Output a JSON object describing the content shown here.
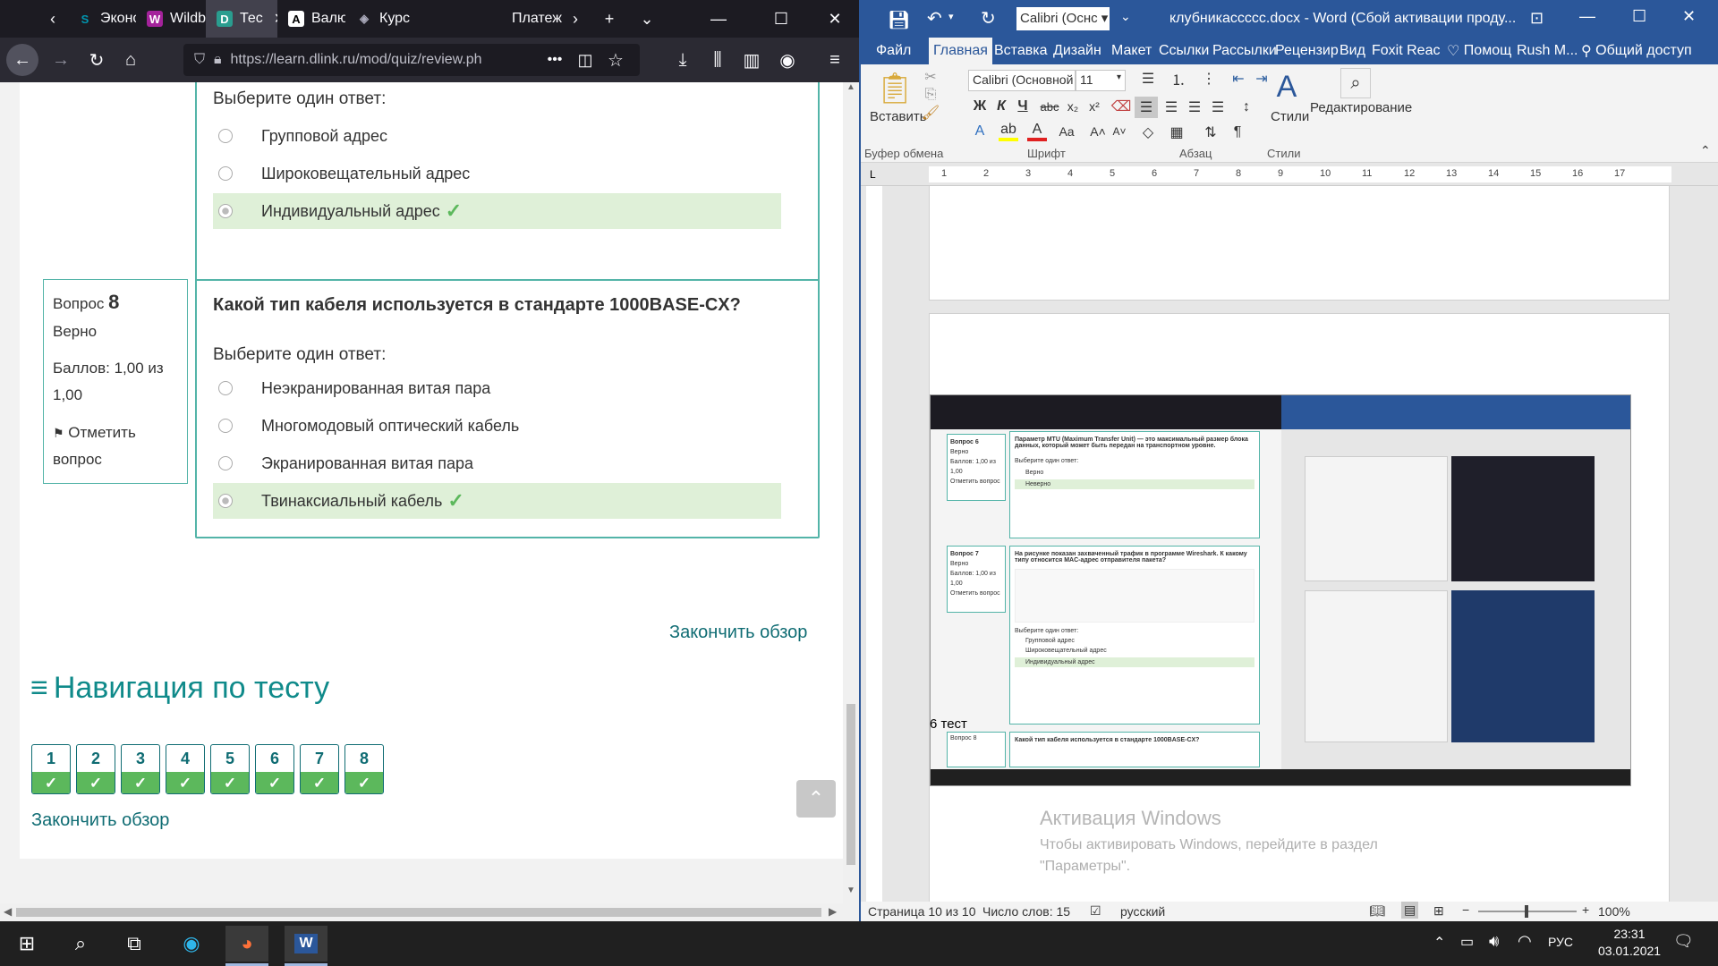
{
  "browser": {
    "tabs": [
      {
        "label": "Эконо",
        "fav": "S",
        "fav_color": "#0096b0"
      },
      {
        "label": "Wildb",
        "fav": "W",
        "fav_color": "#a4229b"
      },
      {
        "label": "Тес",
        "fav": "D",
        "fav_color": "#2a9d8f"
      },
      {
        "label": "Валют",
        "fav": "A",
        "fav_color": "#ffffff"
      },
      {
        "label": "Курс",
        "fav": "◈",
        "fav_color": "#7a8a9a"
      },
      {
        "label": "Платеж",
        "fav": "",
        "fav_color": "#1c1b22"
      }
    ],
    "url": "https://learn.dlink.ru/mod/quiz/review.ph"
  },
  "quiz": {
    "prev_question": {
      "prompt": "Выберите один ответ:",
      "options": [
        {
          "label": "Групповой адрес",
          "correct": false
        },
        {
          "label": "Широковещательный адрес",
          "correct": false
        },
        {
          "label": "Индивидуальный адрес",
          "correct": true
        }
      ]
    },
    "question8": {
      "info_label": "Вопрос",
      "info_number": "8",
      "status": "Верно",
      "score_line1": "Баллов: 1,00 из",
      "score_line2": "1,00",
      "flag_line1": "Отметить",
      "flag_line2": "вопрос",
      "text": "Какой тип кабеля используется в стандарте 1000BASE-CX?",
      "prompt": "Выберите один ответ:",
      "options": [
        {
          "label": "Неэкранированная витая пара",
          "correct": false
        },
        {
          "label": "Многомодовый оптический кабель",
          "correct": false
        },
        {
          "label": "Экранированная витая пара",
          "correct": false
        },
        {
          "label": "Твинаксиальный кабель",
          "correct": true
        }
      ]
    },
    "finish_link": "Закончить обзор",
    "nav_title": "Навигация по тесту",
    "nav_items": [
      "1",
      "2",
      "3",
      "4",
      "5",
      "6",
      "7",
      "8"
    ],
    "finish_link_bottom": "Закончить обзор"
  },
  "word": {
    "title": "клубникассссс.docx  -  Word (Сбой активации проду...",
    "font_box": "Calibri (Оснс",
    "tabs": [
      "Файл",
      "Главная",
      "Вставка",
      "Дизайн",
      "Макет",
      "Ссылки",
      "Рассылки",
      "Рецензир",
      "Вид",
      "Foxit Reac",
      "Помощ",
      "Rush M...",
      "Общий доступ"
    ],
    "ribbon": {
      "paste_label": "Вставить",
      "font_name": "Calibri (Основной",
      "font_size": "11",
      "styles_label": "Стили",
      "editing_label": "Редактирование",
      "group_clipboard": "Буфер обмена",
      "group_font": "Шрифт",
      "group_paragraph": "Абзац",
      "group_styles": "Стили"
    },
    "ruler_numbers": [
      "1",
      "2",
      "3",
      "4",
      "5",
      "6",
      "7",
      "8",
      "9",
      "10",
      "11",
      "12",
      "13",
      "14",
      "15",
      "16",
      "17"
    ],
    "caption": "6 тест",
    "activation_title": "Активация Windows",
    "activation_line1": "Чтобы активировать Windows, перейдите в раздел",
    "activation_line2": "\"Параметры\".",
    "status": {
      "page": "Страница 10 из 10",
      "words": "Число слов: 15",
      "language": "русский",
      "zoom": "100%"
    },
    "thumb": {
      "q6_label": "Вопрос 6",
      "q6_text": "Параметр MTU (Maximum Transfer Unit) — это максимальный размер блока данных, который может быть передан на транспортном уровне.",
      "q6_opt1": "Верно",
      "q6_opt2": "Неверно",
      "q7_label": "Вопрос 7",
      "q7_text": "На рисунке показан захваченный трафик в программе Wireshark. К какому типу относится MAC-адрес отправителя пакета?",
      "q7_opt1": "Групповой адрес",
      "q7_opt2": "Широковещательный адрес",
      "q7_opt3": "Индивидуальный адрес",
      "q8_label": "Вопрос 8",
      "q8_text": "Какой тип кабеля используется в стандарте 1000BASE-CX?",
      "prompt": "Выберите один ответ:",
      "verno": "Верно",
      "score": "Баллов: 1,00 из 1,00",
      "flag": "Отметить вопрос"
    }
  },
  "taskbar": {
    "lang": "РУС",
    "time": "23:31",
    "date": "03.01.2021"
  }
}
